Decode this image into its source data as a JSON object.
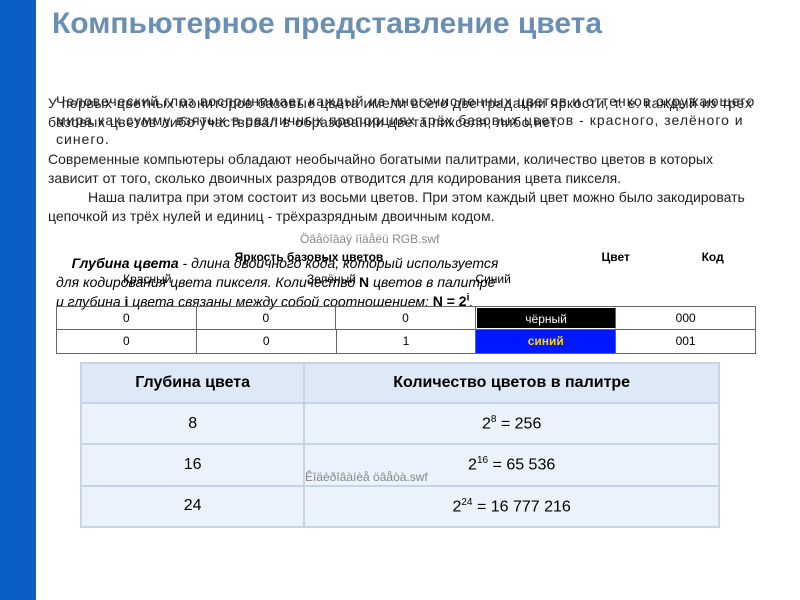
{
  "title": "Компьютерное представление цвета",
  "paragraph_eye": "Человеческий глаз воспринимает каждый из многочисленных цветов и оттенков окружающего мира как сумму взятых в различных пропорциях трёх базовых цветов - красного, зелёного и синего.",
  "paragraph_monitors": "У первых цветных мониторов базовые цвета имели всего две градации яркости, т. е. каждый из трёх базовых цветов либо участвовал в образовании цвета пикселя, либо нет.",
  "paragraph_palettes": "Современные компьютеры обладают необычайно богатыми палитрами, количество цветов в которых зависит от того, сколько двоичных разрядов отводится для кодирования цвета пикселя.",
  "paragraph_palette_tail": "Наша палитра при этом состоит из восьми цветов. При этом каждый цвет можно было закодировать цепочкой из трёх нулей и единиц - трёхразрядным двоичным кодом.",
  "swf1": "Öâåòîâàÿ ìîäåëü RGB.swf",
  "swf2": "Êîäèðîâàíèå öâåòà.swf",
  "defs": {
    "line1_pre": "Глубина цвета",
    "line1_post": " - длина двоичного кода, который используется",
    "line2": "для кодирования цвета пикселя. Количество ",
    "line2_N": "N",
    "line2_post": " цветов в палитре",
    "line3": "и глубина ",
    "line3_i": "i",
    "line3_post": " цвета связаны между собой соотношением: ",
    "line3_eq": "N = 2",
    "line3_sup": "i",
    "line3_dot": "."
  },
  "bright_header_span": "Яркость базовых цветов",
  "bright_cols": {
    "red": "Красный",
    "green": "Зелёный",
    "blue": "Синий",
    "color": "Цвет",
    "code": "Код"
  },
  "row_black": {
    "r": "0",
    "g": "0",
    "b": "0",
    "name": "чёрный",
    "code": "000"
  },
  "row_blue": {
    "r": "0",
    "g": "0",
    "b": "1",
    "name": "синий",
    "code": "001"
  },
  "depth": {
    "h1": "Глубина цвета",
    "h2": "Количество цветов в палитре",
    "rows": [
      {
        "depth": "8",
        "count_base": "2",
        "count_exp": "8",
        "count_eq": " = 256"
      },
      {
        "depth": "16",
        "count_base": "2",
        "count_exp": "16",
        "count_eq": " = 65 536"
      },
      {
        "depth": "24",
        "count_base": "2",
        "count_exp": "24",
        "count_eq": " = 16 777 216"
      }
    ]
  }
}
